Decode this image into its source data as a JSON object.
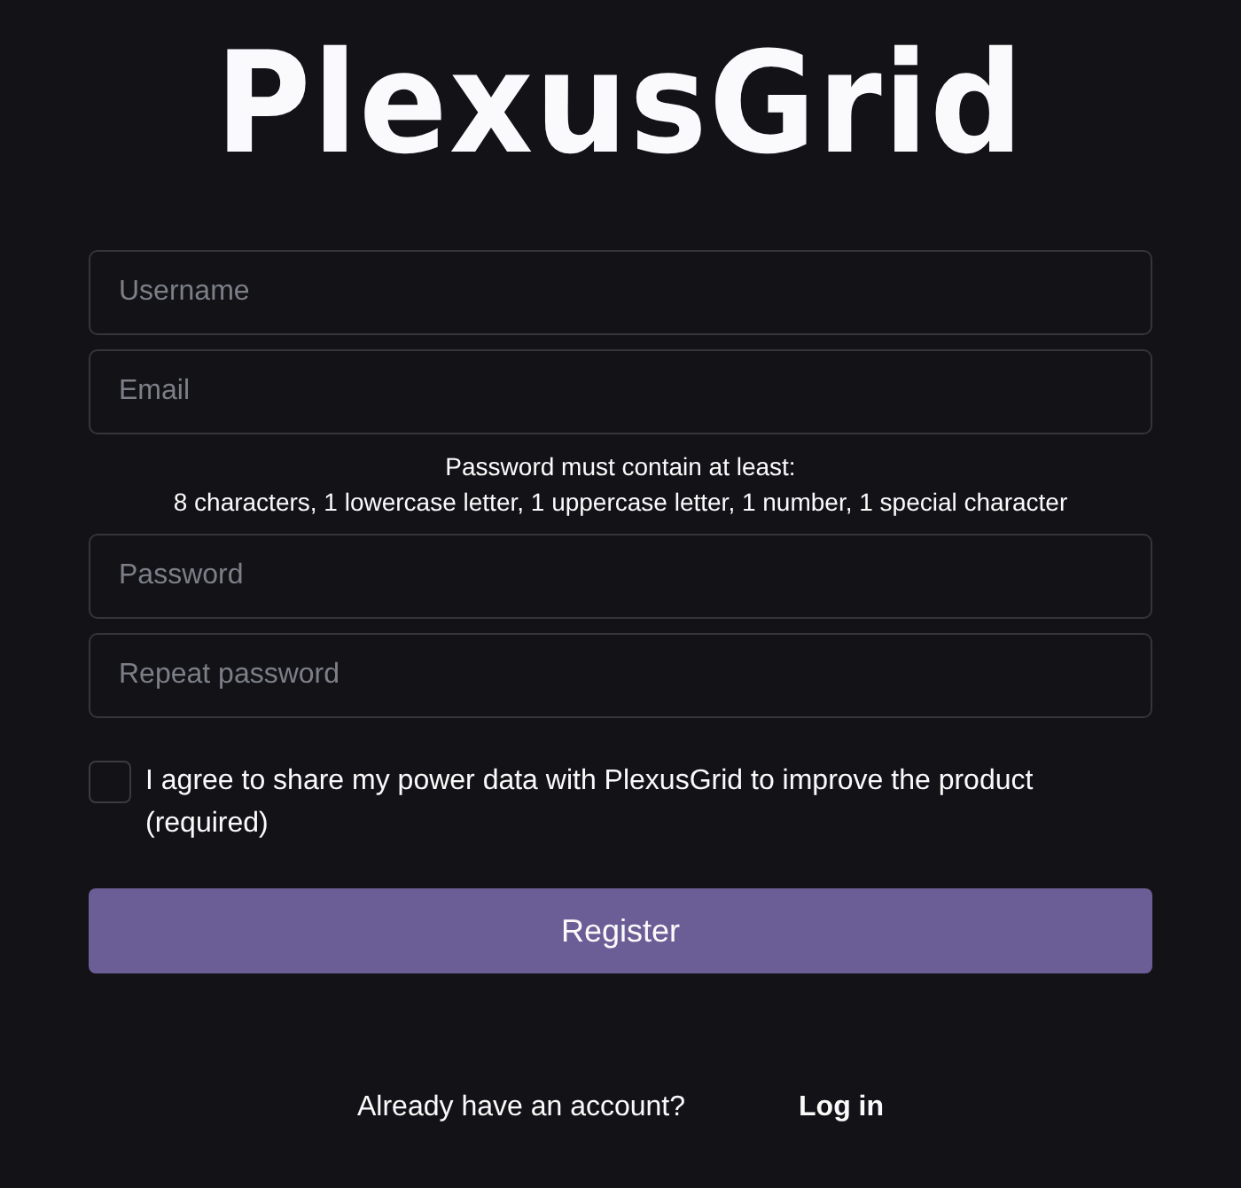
{
  "logo": {
    "text": "PlexusGrid"
  },
  "fields": [
    {
      "kind": "text",
      "placeholder": "Username"
    },
    {
      "kind": "email",
      "placeholder": "Email"
    },
    {
      "kind": "hint",
      "lines": [
        "Password must contain at least:",
        "8 characters, 1 lowercase letter, 1 uppercase letter, 1 number, 1 special character"
      ]
    },
    {
      "kind": "password",
      "placeholder": "Password"
    },
    {
      "kind": "password",
      "placeholder": "Repeat password"
    }
  ],
  "consent": {
    "label": "I agree to share my power data with PlexusGrid to improve the product (required)",
    "checked": false
  },
  "submit": {
    "label": "Register"
  },
  "footer": {
    "text": "Already have an account?",
    "link": "Log in"
  }
}
